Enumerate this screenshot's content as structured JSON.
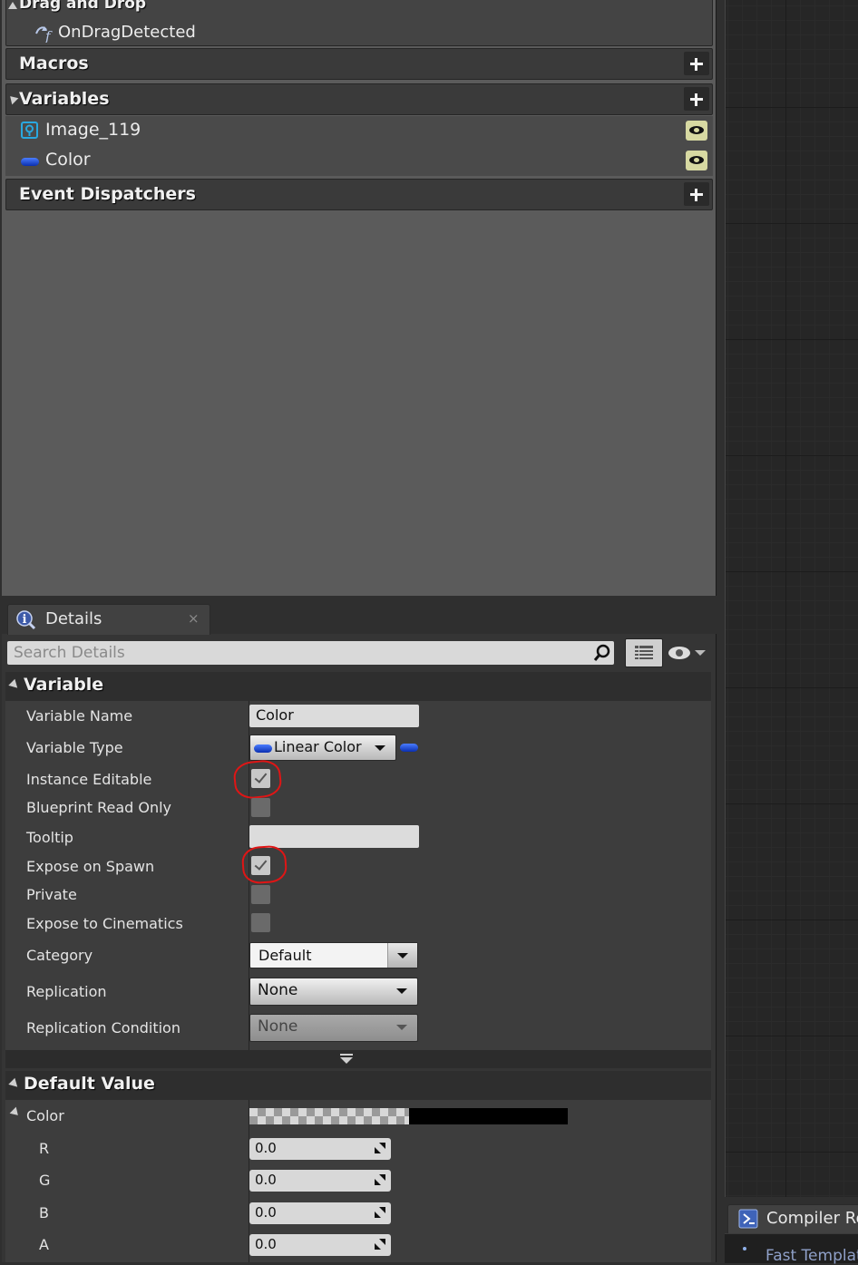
{
  "my_blueprint": {
    "drag_drop": {
      "title": "Drag and Drop",
      "item": "OnDragDetected"
    },
    "macros": {
      "title": "Macros"
    },
    "variables": {
      "title": "Variables",
      "items": [
        {
          "label": "Image_119",
          "icon": "image-widget-icon"
        },
        {
          "label": "Color",
          "icon": "linear-color-pill-icon"
        }
      ]
    },
    "event_dispatchers": {
      "title": "Event Dispatchers"
    }
  },
  "details": {
    "tab_label": "Details",
    "close_glyph": "×",
    "search_placeholder": "Search Details",
    "variable_section": {
      "title": "Variable",
      "variable_name_label": "Variable Name",
      "variable_name_value": "Color",
      "variable_type_label": "Variable Type",
      "variable_type_value": "Linear Color",
      "instance_editable_label": "Instance Editable",
      "instance_editable": true,
      "blueprint_read_only_label": "Blueprint Read Only",
      "blueprint_read_only": false,
      "tooltip_label": "Tooltip",
      "tooltip_value": "",
      "expose_on_spawn_label": "Expose on Spawn",
      "expose_on_spawn": true,
      "private_label": "Private",
      "private": false,
      "expose_to_cinematics_label": "Expose to Cinematics",
      "expose_to_cinematics": false,
      "category_label": "Category",
      "category_value": "Default",
      "replication_label": "Replication",
      "replication_value": "None",
      "replication_condition_label": "Replication Condition",
      "replication_condition_value": "None"
    },
    "default_value_section": {
      "title": "Default Value",
      "color_label": "Color",
      "channels": [
        {
          "label": "R",
          "value": "0.0"
        },
        {
          "label": "G",
          "value": "0.0"
        },
        {
          "label": "B",
          "value": "0.0"
        },
        {
          "label": "A",
          "value": "0.0"
        }
      ]
    }
  },
  "compiler": {
    "tab_label": "Compiler Re",
    "first_line": "Fast Template"
  },
  "colors": {
    "annotation_red": "#e01515",
    "color_pin_blue": "#1a4fe0",
    "image_pin_cyan": "#29a8e0"
  }
}
